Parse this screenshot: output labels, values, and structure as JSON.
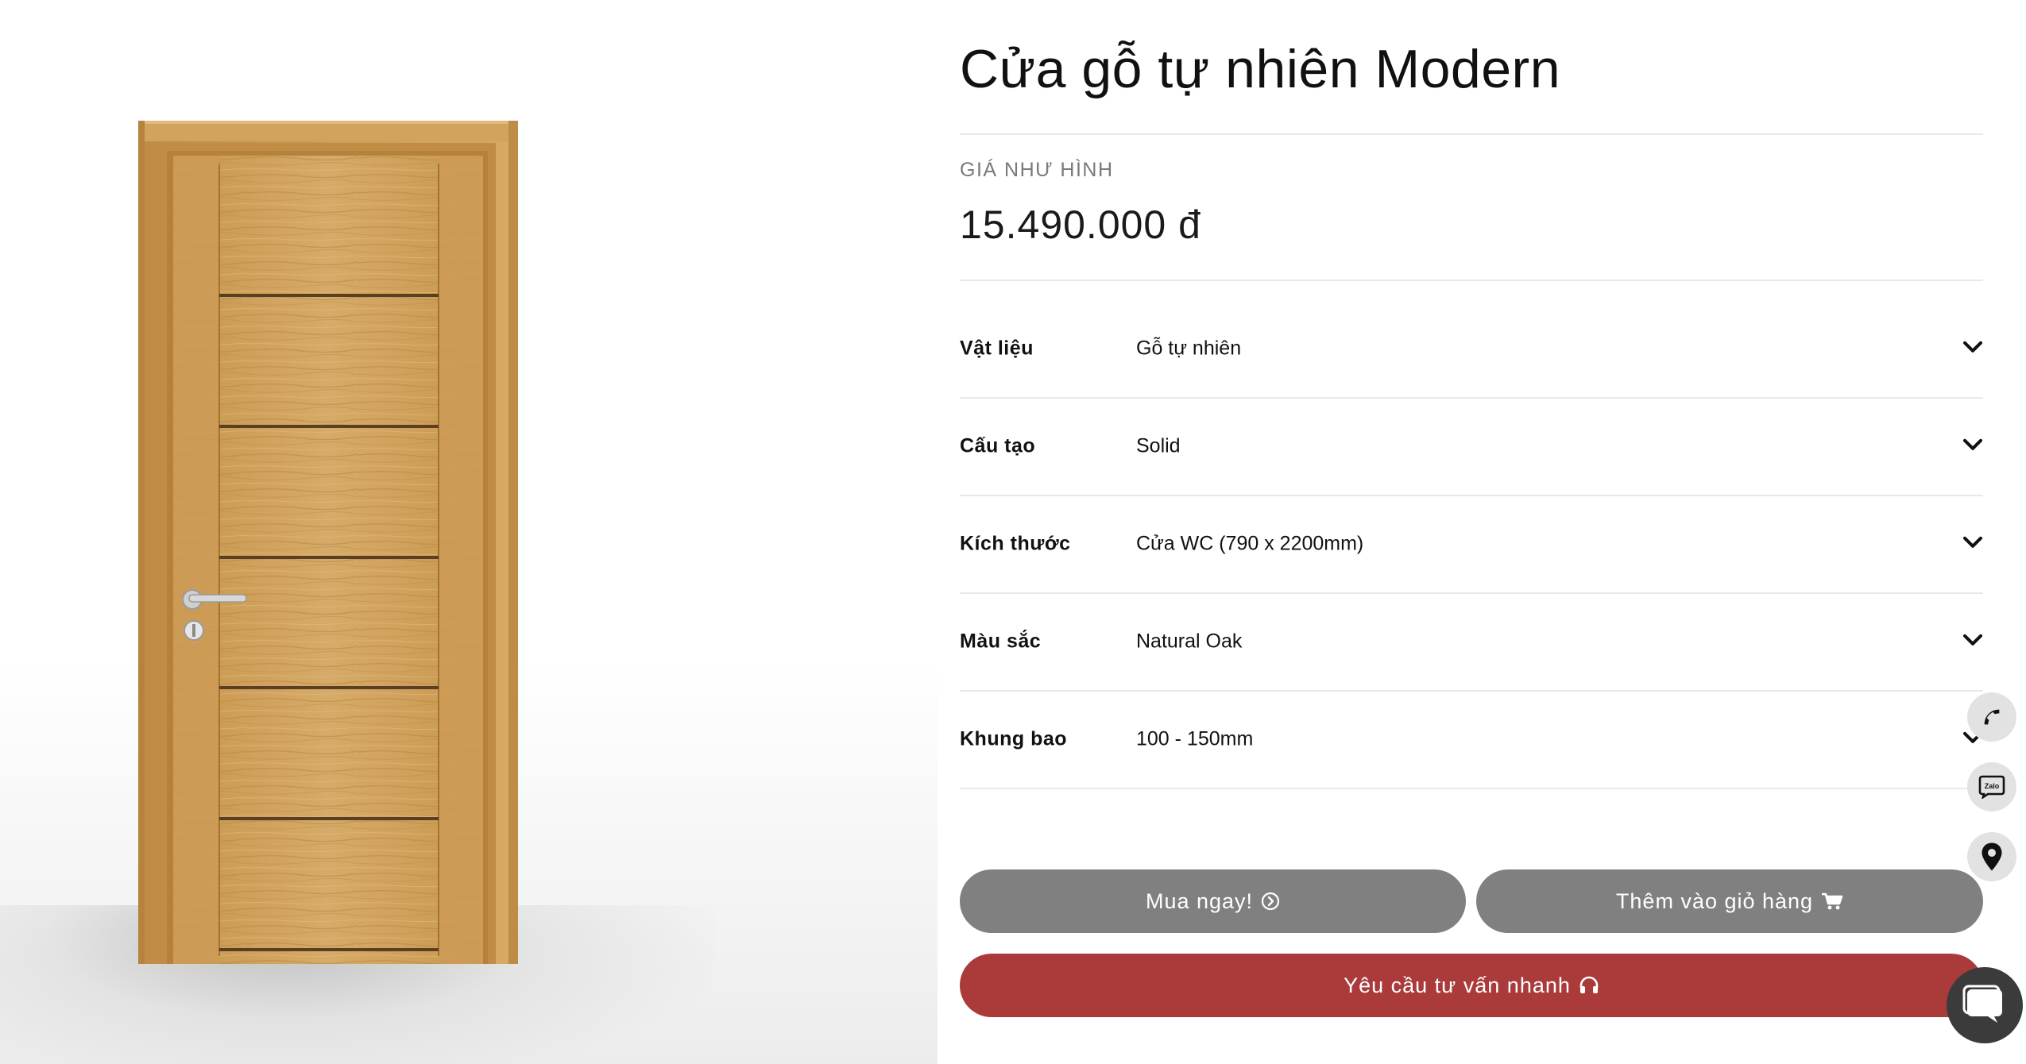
{
  "product": {
    "title": "Cửa gỗ tự nhiên Modern",
    "price_label": "GIÁ NHƯ HÌNH",
    "price": "15.490.000 đ"
  },
  "options": [
    {
      "label": "Vật liệu",
      "value": "Gỗ tự nhiên"
    },
    {
      "label": "Cấu tạo",
      "value": "Solid"
    },
    {
      "label": "Kích thước",
      "value": "Cửa WC (790 x 2200mm)"
    },
    {
      "label": "Màu sắc",
      "value": "Natural Oak"
    },
    {
      "label": "Khung bao",
      "value": "100 - 150mm"
    }
  ],
  "actions": {
    "buy_now": "Mua ngay!",
    "add_to_cart": "Thêm vào giỏ hàng",
    "quick_consult": "Yêu cầu tư vấn nhanh"
  },
  "floating": {
    "zalo_text": "Zalo"
  },
  "icons": {
    "buy_now": "arrow-circle-right-icon",
    "add_to_cart": "cart-icon",
    "quick_consult": "headset-icon",
    "option_toggle": "chevron-down-icon",
    "floating": [
      "phone-icon",
      "zalo-icon",
      "map-pin-icon",
      "chat-icon"
    ]
  },
  "colors": {
    "gray_button": "#808080",
    "red_button": "#ab3b3b",
    "door_wood": "#d1a461",
    "floating_bg": "#e2e2e2",
    "chat_bg": "#3b3b3b"
  }
}
